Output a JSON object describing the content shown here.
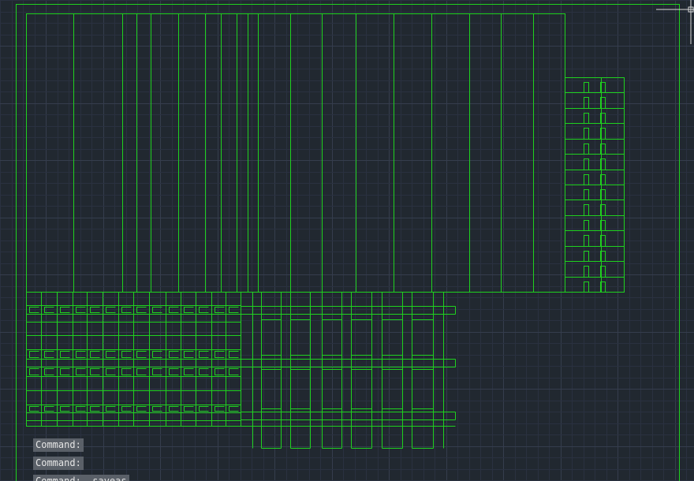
{
  "command_history": [
    "Command:",
    "Command:",
    "Command:  _saveas"
  ],
  "colors": {
    "background": "#212830",
    "geometry": "#1fd11f",
    "grid_minor": "#2a3140",
    "grid_major": "#353d4d",
    "crosshair": "#d9d9d9"
  },
  "icons": {
    "cursor": "crosshair-cursor-icon"
  }
}
